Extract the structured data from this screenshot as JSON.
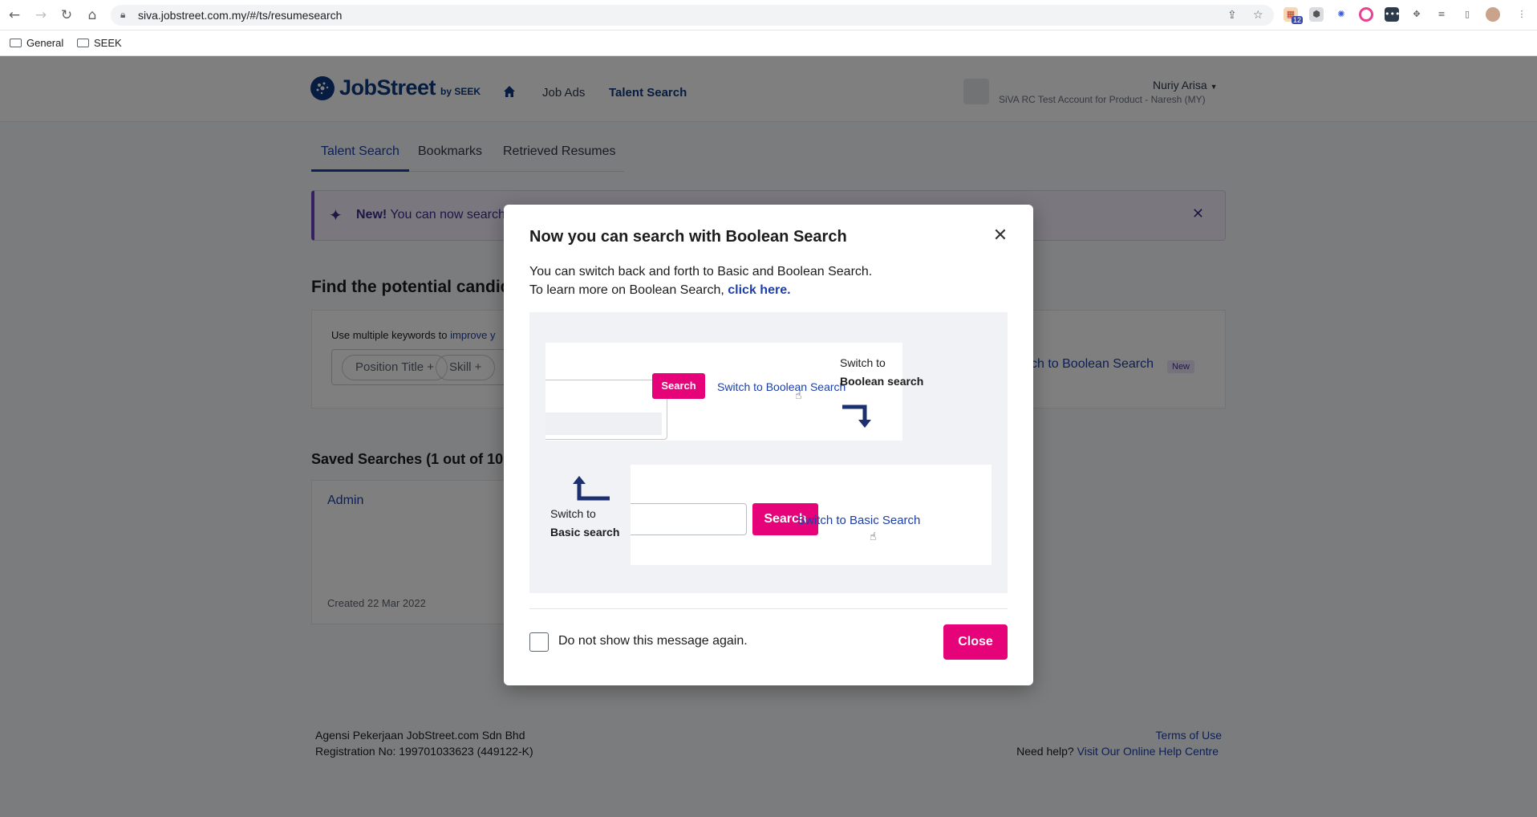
{
  "browser": {
    "url": "siva.jobstreet.com.my/#/ts/resumesearch",
    "extension_badge": "12",
    "bookmarks": [
      {
        "label": "General"
      },
      {
        "label": "SEEK"
      }
    ]
  },
  "header": {
    "logo_text": "JobStreet",
    "logo_by": "by SEEK",
    "nav": {
      "job_ads": "Job Ads",
      "talent_search": "Talent Search"
    },
    "user_name": "Nuriy Arisa",
    "user_account": "SiVA RC Test Account for Product - Naresh (MY)"
  },
  "tabs": [
    {
      "label": "Talent Search"
    },
    {
      "label": "Bookmarks"
    },
    {
      "label": "Retrieved Resumes"
    }
  ],
  "banner": {
    "new_label": "New!",
    "text": "You can now search"
  },
  "find": {
    "title": "Find the potential candida",
    "hint_prefix": "Use multiple keywords to ",
    "hint_link": "improve y",
    "chips": [
      "Position Title +",
      "Skill +"
    ],
    "switch_boolean": "itch to Boolean Search",
    "new_badge": "New"
  },
  "saved": {
    "title": "Saved Searches (1 out of 10 u",
    "card_name": "Admin",
    "card_created": "Created 22 Mar 2022"
  },
  "footer": {
    "company": "Agensi Pekerjaan JobStreet.com Sdn Bhd",
    "registration": "Registration No: 199701033623 (449122-K)",
    "terms": "Terms of Use",
    "help_prefix": "Need help? ",
    "help_link": "Visit Our Online Help Centre"
  },
  "modal": {
    "title": "Now you can search with Boolean Search",
    "line1": "You can switch back and forth to Basic and Boolean Search.",
    "line2_prefix": "To learn more on Boolean Search, ",
    "line2_link": "click here.",
    "illustration": {
      "search_btn": "Search",
      "switch_boolean_link": "Switch to Boolean Search",
      "switch_to_1": "Switch to",
      "boolean_search_label": "Boolean search",
      "search_btn_2": "Search",
      "switch_basic_link": "Switch to Basic Search",
      "switch_to_2": "Switch to",
      "basic_search_label": "Basic search"
    },
    "checkbox_label": "Do not show this message again.",
    "close_btn": "Close"
  },
  "colors": {
    "brand_blue": "#0d3880",
    "link_blue": "#1c3fa8",
    "pink": "#e60278"
  }
}
